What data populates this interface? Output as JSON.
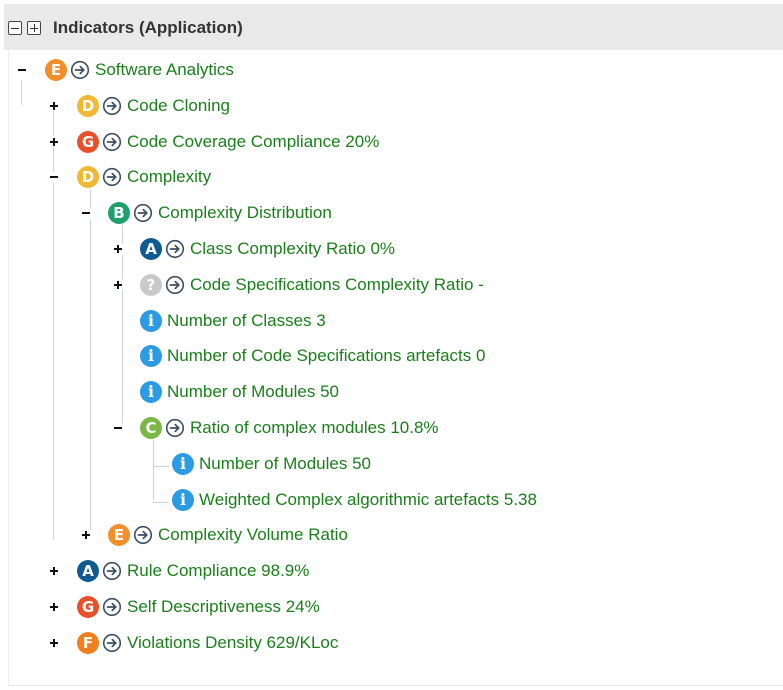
{
  "header": {
    "title": "Indicators (Application)",
    "collapse_all_icon": "collapse-all-icon",
    "expand_all_icon": "expand-all-icon"
  },
  "colors": {
    "label_green": "#1a7f1a",
    "grade_A": "#0f5a91",
    "grade_B": "#1f9e6e",
    "grade_C": "#78b843",
    "grade_D": "#f2b733",
    "grade_E": "#f28f2b",
    "grade_F": "#f07f1e",
    "grade_G": "#e8502a",
    "grade_unknown": "#c9c9c9",
    "info_blue": "#2b9be6"
  },
  "tree": {
    "nodes": [
      {
        "label": "Software Analytics",
        "kind": "grade",
        "grade": "E",
        "has_arrow": true,
        "toggle": "minus"
      },
      {
        "label": "Code Cloning",
        "kind": "grade",
        "grade": "D",
        "has_arrow": true,
        "toggle": "plus"
      },
      {
        "label": "Code Coverage Compliance 20%",
        "kind": "grade",
        "grade": "G",
        "has_arrow": true,
        "toggle": "plus"
      },
      {
        "label": "Complexity",
        "kind": "grade",
        "grade": "D",
        "has_arrow": true,
        "toggle": "minus"
      },
      {
        "label": "Complexity Distribution",
        "kind": "grade",
        "grade": "B",
        "has_arrow": true,
        "toggle": "minus"
      },
      {
        "label": "Class Complexity Ratio 0%",
        "kind": "grade",
        "grade": "A",
        "has_arrow": true,
        "toggle": "plus"
      },
      {
        "label": "Code Specifications Complexity Ratio -",
        "kind": "grade",
        "grade": "?",
        "has_arrow": true,
        "toggle": "plus"
      },
      {
        "label": "Number of Classes 3",
        "kind": "info",
        "grade": "i",
        "has_arrow": false,
        "toggle": "none"
      },
      {
        "label": "Number of Code Specifications artefacts 0",
        "kind": "info",
        "grade": "i",
        "has_arrow": false,
        "toggle": "none"
      },
      {
        "label": "Number of Modules 50",
        "kind": "info",
        "grade": "i",
        "has_arrow": false,
        "toggle": "none"
      },
      {
        "label": "Ratio of complex modules 10.8%",
        "kind": "grade",
        "grade": "C",
        "has_arrow": true,
        "toggle": "minus"
      },
      {
        "label": "Number of Modules 50",
        "kind": "info",
        "grade": "i",
        "has_arrow": false,
        "toggle": "none"
      },
      {
        "label": "Weighted Complex algorithmic artefacts 5.38",
        "kind": "info",
        "grade": "i",
        "has_arrow": false,
        "toggle": "none"
      },
      {
        "label": "Complexity Volume Ratio",
        "kind": "grade",
        "grade": "E",
        "has_arrow": true,
        "toggle": "plus"
      },
      {
        "label": "Rule Compliance 98.9%",
        "kind": "grade",
        "grade": "A",
        "has_arrow": true,
        "toggle": "plus"
      },
      {
        "label": "Self Descriptiveness 24%",
        "kind": "grade",
        "grade": "G",
        "has_arrow": true,
        "toggle": "plus"
      },
      {
        "label": "Violations Density 629/KLoc",
        "kind": "grade",
        "grade": "F",
        "has_arrow": true,
        "toggle": "plus"
      }
    ]
  }
}
